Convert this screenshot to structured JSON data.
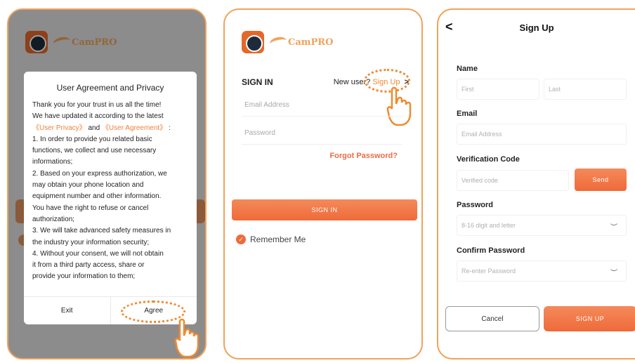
{
  "brand": {
    "name": "CamPRO"
  },
  "agreement": {
    "title": "User Agreement and Privacy",
    "lines": [
      "Thank you for your trust in us all the time!",
      "We have updated it according to the latest",
      "1. In order to provide you related basic",
      "functions, we collect and use necessary",
      "informations;",
      "2. Based on your express authorization, we",
      "may obtain your phone location and",
      "equipment number and other information.",
      "You have the right to refuse or cancel",
      "authorization;",
      "3. We will take advanced safety measures in",
      "the industry your information security;",
      "4. Without your consent, we will not obtain",
      "it from a third party access, share or",
      "provide your information to them;"
    ],
    "privacy_link": "《User Privacy》",
    "and_text": "and",
    "agreement_link": "《User Agreement》",
    "colon": ":",
    "exit_label": "Exit",
    "agree_label": "Agree"
  },
  "signin": {
    "title": "SIGN IN",
    "new_user_text": "New user?",
    "signup_link": "Sign Up",
    "chevron": ">",
    "email_placeholder": "Email Address",
    "password_placeholder": "Password",
    "forgot_label": "Forgot Password?",
    "submit_label": "SIGN IN",
    "remember_label": "Remember Me"
  },
  "signup": {
    "back": "<",
    "title": "Sign Up",
    "name_label": "Name",
    "first_placeholder": "First",
    "last_placeholder": "Last",
    "email_label": "Email",
    "email_placeholder": "Email Address",
    "verification_label": "Verification Code",
    "verification_placeholder": "Verified code",
    "send_label": "Send",
    "password_label": "Password",
    "password_placeholder": "8-16 digit and letter",
    "confirm_label": "Confirm Password",
    "confirm_placeholder": "Re-enter Password",
    "cancel_label": "Cancel",
    "submit_label": "SIGN UP"
  },
  "colors": {
    "accent": "#ef6a3a",
    "border": "#f0a35a"
  }
}
